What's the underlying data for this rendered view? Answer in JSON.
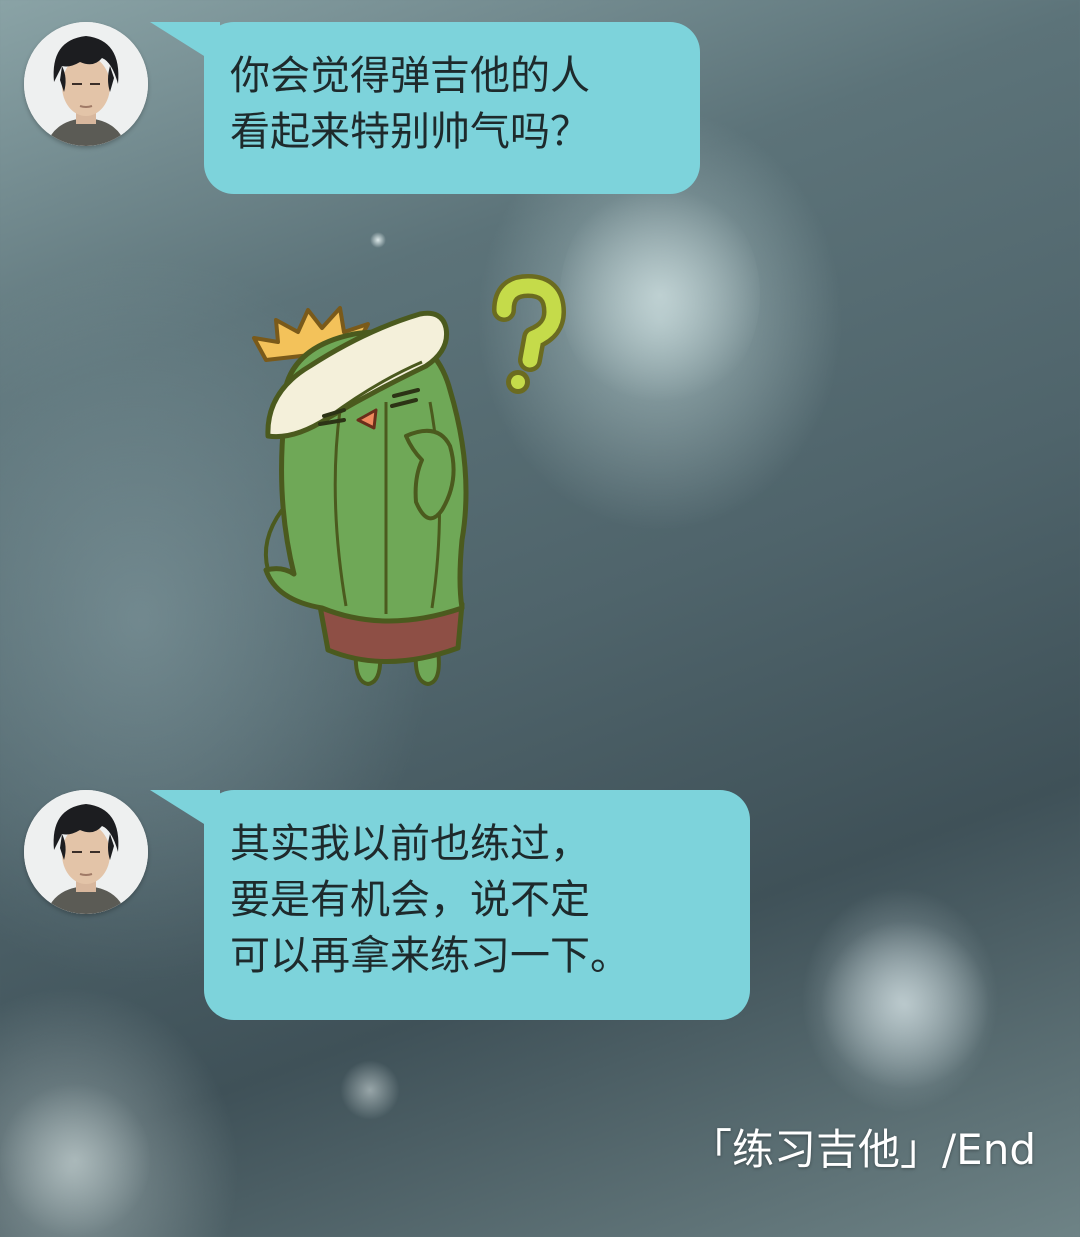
{
  "theme": {
    "bubble_color": "#7dd3db",
    "text_color": "#1e2a2c",
    "sticker_body_color": "#6fa857",
    "sticker_question_color": "#c5db4a"
  },
  "messages": [
    {
      "sender_avatar": "young-man-avatar",
      "lines": [
        "你会觉得弹吉他的人",
        "看起来特别帅气吗？"
      ]
    },
    {
      "type": "sticker",
      "sticker": "cactus-thinking-sticker"
    },
    {
      "sender_avatar": "young-man-avatar",
      "lines": [
        "其实我以前也练过，",
        "要是有机会，说不定",
        "可以再拿来练习一下。"
      ]
    }
  ],
  "footer": {
    "end_label": "「练习吉他」/End"
  }
}
